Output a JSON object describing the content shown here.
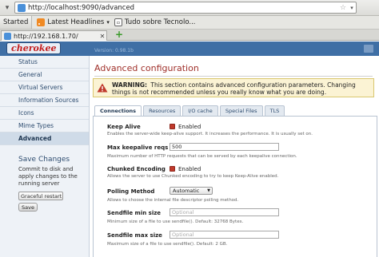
{
  "browser": {
    "url": "http://localhost:9090/advanced",
    "bookmarks": {
      "started": "Started",
      "latest_headlines": "Latest Headlines",
      "tudo_sobre": "Tudo sobre Tecnolo..."
    },
    "tab_title": "http://192.168.1.70/"
  },
  "app": {
    "logo": "cherokee",
    "version": "Version: 0.98.1b"
  },
  "sidebar": {
    "items": [
      {
        "label": "Status"
      },
      {
        "label": "General"
      },
      {
        "label": "Virtual Servers"
      },
      {
        "label": "Information Sources"
      },
      {
        "label": "Icons"
      },
      {
        "label": "Mime Types"
      },
      {
        "label": "Advanced"
      }
    ],
    "save": {
      "title": "Save Changes",
      "text": "Commit to disk and apply changes to the running server",
      "restart_option": "Graceful restart",
      "button": "Save"
    }
  },
  "main": {
    "title": "Advanced configuration",
    "warning_label": "WARNING:",
    "warning_text": "This section contains advanced configuration parameters. Changing things is not recommended unless you really know what you are doing.",
    "tabs": [
      {
        "label": "Connections"
      },
      {
        "label": "Resources"
      },
      {
        "label": "I/O cache"
      },
      {
        "label": "Special Files"
      },
      {
        "label": "TLS"
      }
    ],
    "settings": [
      {
        "label": "Keep Alive",
        "value": "Enabled",
        "desc": "Enables the server-wide keep-alive support. It increases the performance. It is usually set on."
      },
      {
        "label": "Max keepalive reqs",
        "value": "500",
        "desc": "Maximum number of HTTP requests that can be served by each keepalive connection."
      },
      {
        "label": "Chunked Encoding",
        "value": "Enabled",
        "desc": "Allows the server to use Chunked encoding to try to keep Keep-Alive enabled."
      },
      {
        "label": "Polling Method",
        "value": "Automatic",
        "desc": "Allows to choose the internal file descriptor polling method."
      },
      {
        "label": "Sendfile min size",
        "placeholder": "Optional",
        "desc": "Minimum size of a file to use sendfile(). Default: 32768 Bytes."
      },
      {
        "label": "Sendfile max size",
        "placeholder": "Optional",
        "desc": "Maximum size of a file to use sendfile(). Default: 2 GB."
      }
    ]
  }
}
